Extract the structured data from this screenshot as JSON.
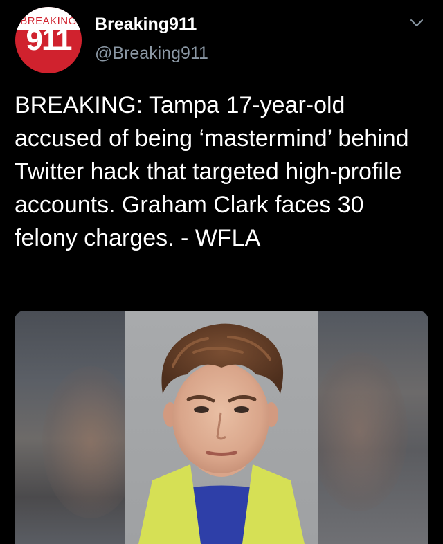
{
  "account": {
    "display_name": "Breaking911",
    "handle": "@Breaking911",
    "avatar": {
      "top_text": "BREAKING",
      "number": "911",
      "colors": {
        "red": "#d0222e",
        "white": "#ffffff"
      }
    }
  },
  "menu": {
    "icon": "chevron-down-icon"
  },
  "tweet": {
    "text": "BREAKING: Tampa 17-year-old accused of being ‘mastermind’ behind Twitter hack that targeted high-profile accounts. Graham Clark faces 30 felony charges. - WFLA"
  },
  "media": {
    "type": "photo"
  },
  "colors": {
    "background": "#000000",
    "text": "#ffffff",
    "secondary_text": "#8b98a5"
  }
}
